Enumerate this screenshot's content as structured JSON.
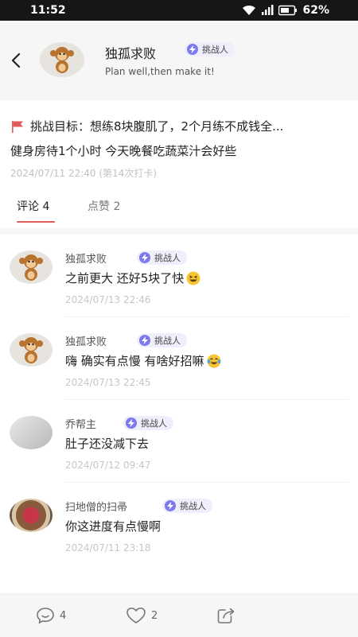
{
  "status_bar": {
    "time": "11:52",
    "battery": "62%"
  },
  "header": {
    "author_name": "独孤求败",
    "author_badge": "挑战人",
    "author_motto": "Plan well,then make it!"
  },
  "post": {
    "goal": "挑战目标：想练8块腹肌了，2个月练不成钱全...",
    "checkin_text": "健身房待1个小时 今天晚餐吃蔬菜汁会好些",
    "checkin_meta": "2024/07/11 22:40 (第14次打卡)"
  },
  "tabs": [
    {
      "label": "评论 4"
    },
    {
      "label": "点赞 2"
    }
  ],
  "comments": [
    {
      "name": "独孤求败",
      "badge": "挑战人",
      "text": "之前更大 还好5块了快",
      "emoji": "grinning-squint-face",
      "time": "2024/07/13 22:46"
    },
    {
      "name": "独孤求败",
      "badge": "挑战人",
      "text": "嗨 确实有点慢 有啥好招嘛",
      "emoji": "tears-of-joy-face",
      "time": "2024/07/13 22:45"
    },
    {
      "name": "乔帮主",
      "badge": "挑战人",
      "text": "肚子还没减下去",
      "time": "2024/07/12 09:47"
    },
    {
      "name": "扫地僧的扫帚",
      "badge": "挑战人",
      "text": "你这进度有点慢啊",
      "time": "2024/07/11 23:18"
    }
  ],
  "bottom_bar": {
    "comment_count": "4",
    "like_count": "2"
  },
  "colors": {
    "accent_red": "#e05b5b",
    "badge_purple": "#7d79ef"
  }
}
